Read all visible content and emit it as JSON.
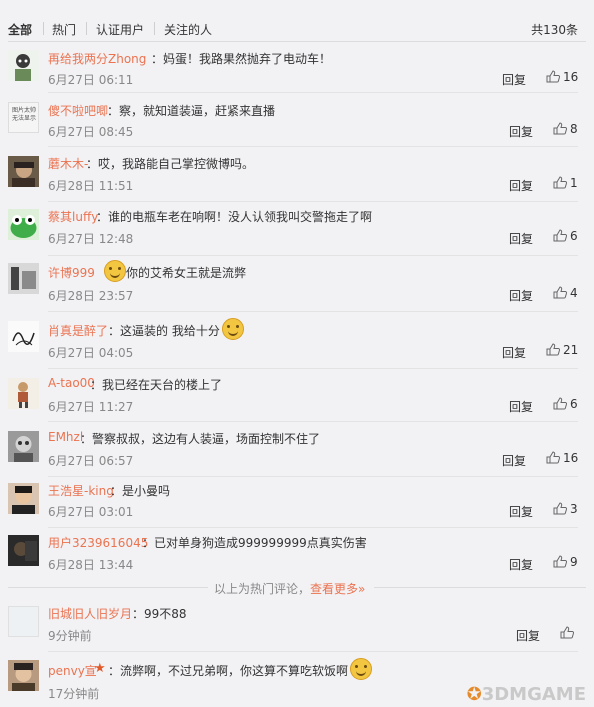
{
  "tabs": [
    {
      "label": "全部",
      "active": true
    },
    {
      "label": "热门",
      "active": false
    },
    {
      "label": "认证用户",
      "active": false
    },
    {
      "label": "关注的人",
      "active": false
    }
  ],
  "total": "共130条",
  "reply_label": "回复",
  "hot_notice": {
    "text": "以上为热门评论，",
    "link": "查看更多»"
  },
  "watermark": "3DMGAME",
  "accent_color": "#eb7350",
  "comments": [
    {
      "name": "再给我两分Zhong",
      "text": "妈蛋！我路果然抛弃了电动车！",
      "time": "6月27日 06:11",
      "likes": "16"
    },
    {
      "name": "傻不啦吧唧",
      "text": "察，就知道装逼，赶紧来直播",
      "time": "6月27日 08:45",
      "likes": "8",
      "avatar_text": "图片太帅无法显示"
    },
    {
      "name": "蘑木木-",
      "text": "哎，我路能自己掌控微博吗。",
      "time": "6月28日 11:51",
      "likes": "1"
    },
    {
      "name": "蔡其luffy",
      "text": "谁的电瓶车老在响啊！没人认领我叫交警拖走了啊",
      "time": "6月27日 12:48",
      "likes": "6"
    },
    {
      "name": "许博999",
      "text": "你的艾希女王就是流弊",
      "time": "6月28日 23:57",
      "likes": "4"
    },
    {
      "name": "肖真是醉了",
      "text": "这逼装的 我给十分",
      "time": "6月27日 04:05",
      "likes": "21"
    },
    {
      "name": "A-tao00",
      "text": "我已经在天台的楼上了",
      "time": "6月27日 11:27",
      "likes": "6"
    },
    {
      "name": "EMhzl",
      "text": "警察叔叔，这边有人装逼，场面控制不住了",
      "time": "6月27日 06:57",
      "likes": "16"
    },
    {
      "name": "王浩星-king",
      "text": "是小曼吗",
      "time": "6月27日 03:01",
      "likes": "3"
    },
    {
      "name": "用户3239616045",
      "text": "已对单身狗造成999999999点真实伤害",
      "time": "6月28日 13:44",
      "likes": "9"
    },
    {
      "name": "旧城旧人旧岁月",
      "text": "99不88",
      "time": "9分钟前",
      "likes": ""
    },
    {
      "name": "penvy宣",
      "text": "流弊啊，不过兄弟啊，你这算不算吃软饭啊",
      "time": "17分钟前",
      "likes": ""
    }
  ]
}
